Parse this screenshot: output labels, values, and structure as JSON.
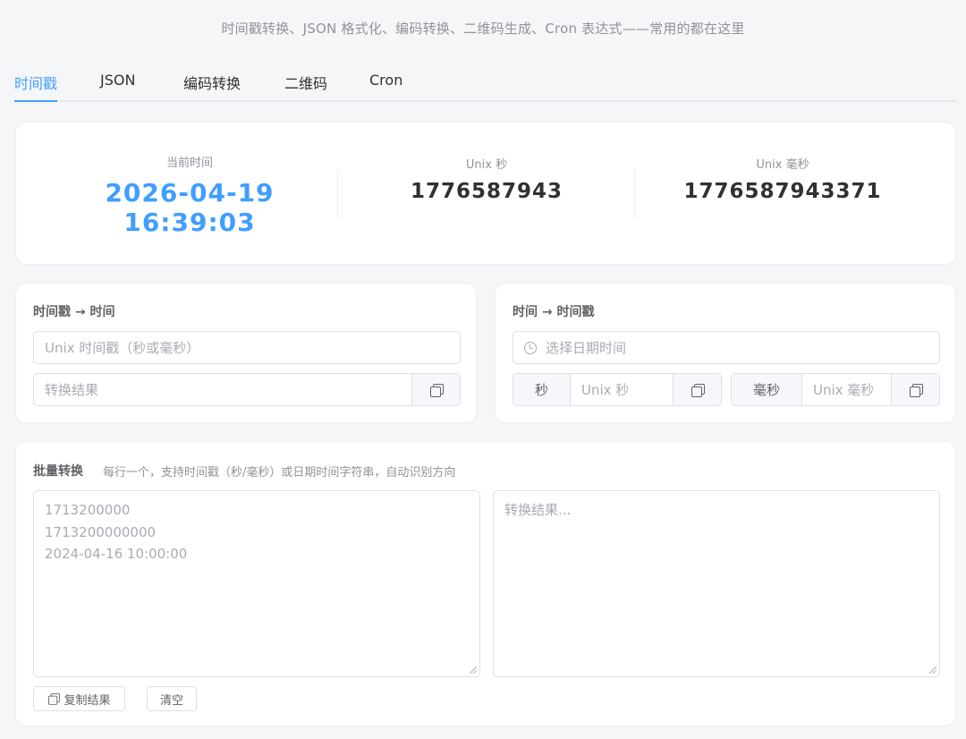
{
  "header": {
    "subtitle": "时间戳转换、JSON 格式化、编码转换、二维码生成、Cron 表达式——常用的都在这里"
  },
  "tabs": [
    {
      "label": "时间戳",
      "active": true
    },
    {
      "label": "JSON",
      "active": false
    },
    {
      "label": "编码转换",
      "active": false
    },
    {
      "label": "二维码",
      "active": false
    },
    {
      "label": "Cron",
      "active": false
    }
  ],
  "current": {
    "now_label": "当前时间",
    "now_value": "2026-04-19 16:39:03",
    "sec_label": "Unix 秒",
    "sec_value": "1776587943",
    "ms_label": "Unix 毫秒",
    "ms_value": "1776587943371"
  },
  "ts_to_time": {
    "title": "时间戳 → 时间",
    "input_placeholder": "Unix 时间戳（秒或毫秒）",
    "result_placeholder": "转换结果"
  },
  "time_to_ts": {
    "title": "时间 → 时间戳",
    "date_placeholder": "选择日期时间",
    "sec_addon": "秒",
    "sec_placeholder": "Unix 秒",
    "ms_addon": "毫秒",
    "ms_placeholder": "Unix 毫秒"
  },
  "batch": {
    "title": "批量转换",
    "hint": "每行一个，支持时间戳（秒/毫秒）或日期时间字符串，自动识别方向",
    "input_lines": [
      "1713200000",
      "1713200000000",
      "2024-04-16 10:00:00"
    ],
    "output_placeholder": "转换结果...",
    "copy_label": "复制结果",
    "clear_label": "清空"
  },
  "colors": {
    "accent": "#409eff",
    "background": "#f5f6f8"
  }
}
